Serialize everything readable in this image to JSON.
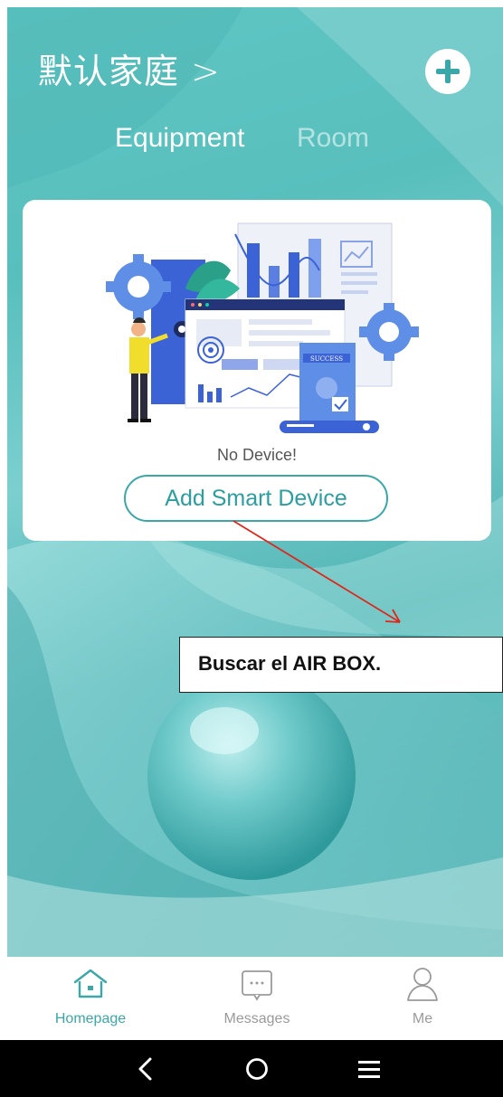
{
  "header": {
    "home_name": "默认家庭 >",
    "add_icon": "plus-icon"
  },
  "tabs": [
    {
      "label": "Equipment",
      "active": true
    },
    {
      "label": "Room",
      "active": false
    }
  ],
  "card": {
    "illustration_badge": "SUCCESS",
    "empty_text": "No Device!",
    "add_button_label": "Add Smart Device"
  },
  "annotation": {
    "text": "Buscar el AIR BOX."
  },
  "bottom_nav": [
    {
      "label": "Homepage",
      "icon": "home-icon",
      "active": true
    },
    {
      "label": "Messages",
      "icon": "message-icon",
      "active": false
    },
    {
      "label": "Me",
      "icon": "user-icon",
      "active": false
    }
  ],
  "system_nav": {
    "back_icon": "back-chevron-icon",
    "home_icon": "home-circle-icon",
    "menu_icon": "menu-icon"
  },
  "colors": {
    "accent": "#3aa7a8",
    "background_teal": "#5fc6c4",
    "annotation_arrow": "#e0261b"
  }
}
